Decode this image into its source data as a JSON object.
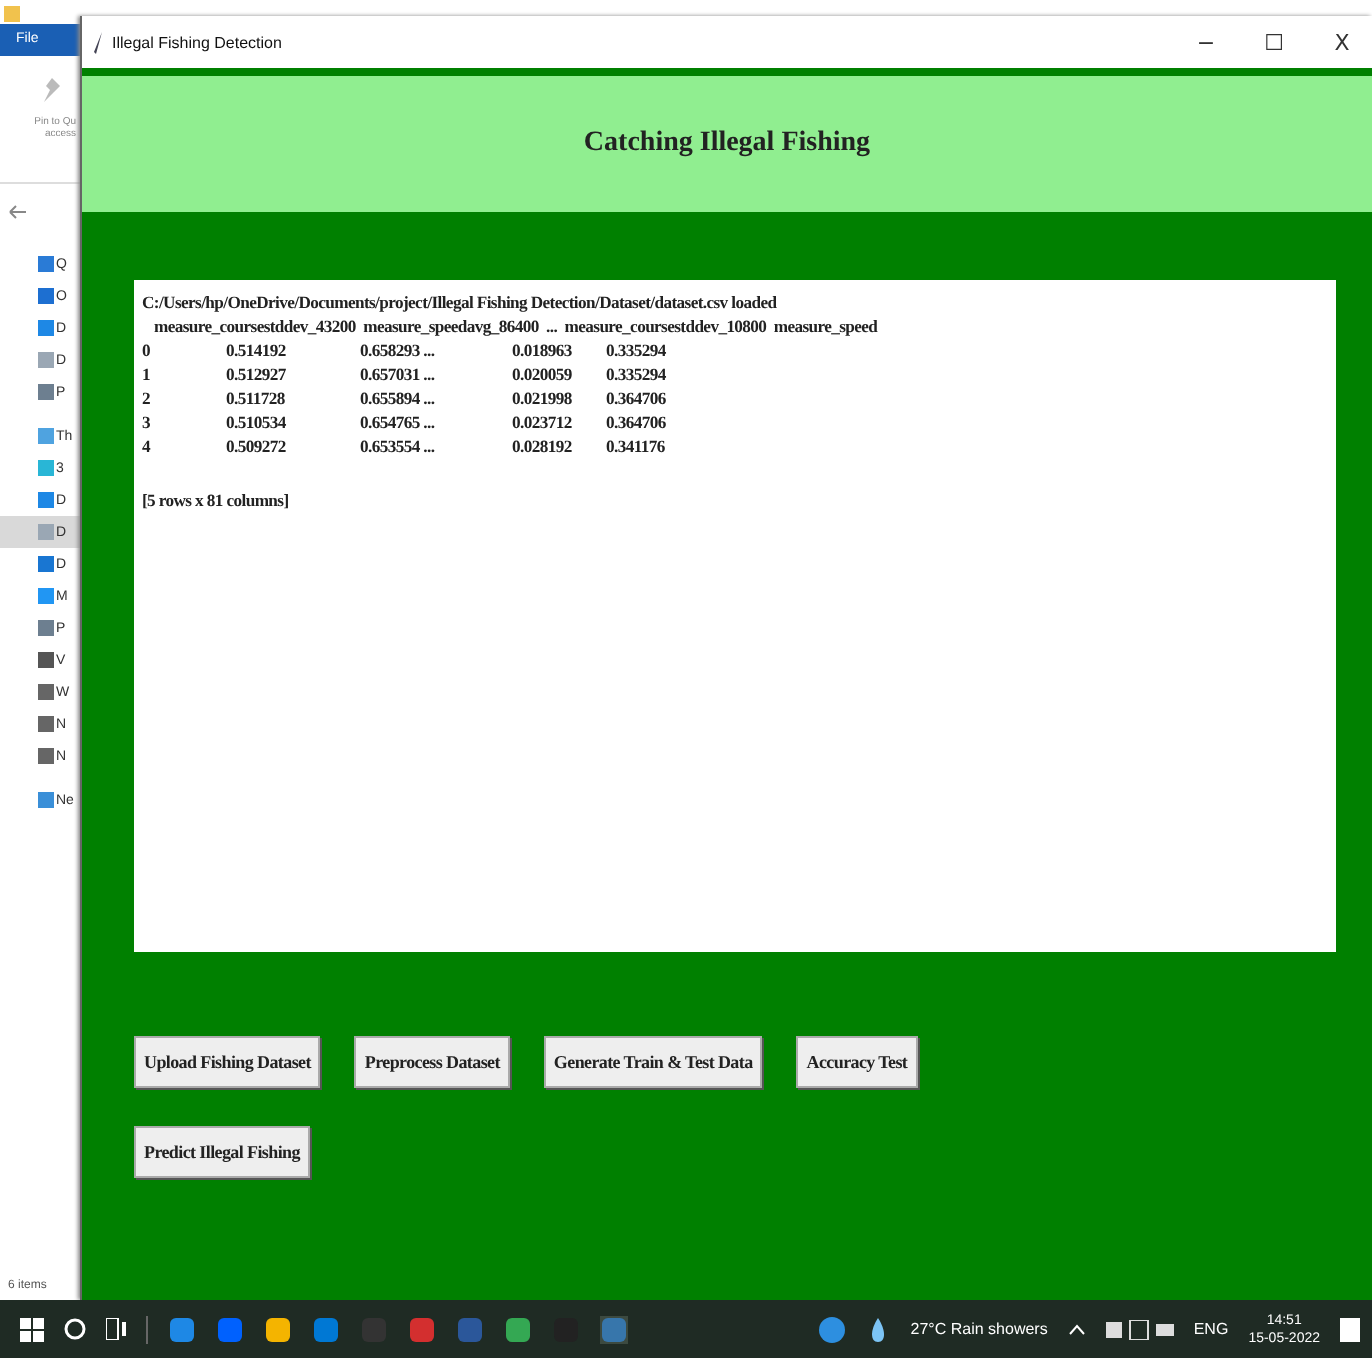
{
  "explorer": {
    "menu": "File",
    "pin_label": [
      "Pin to Qu",
      "access"
    ],
    "nav": [
      {
        "label": "Q",
        "kind": "star",
        "selected": false
      },
      {
        "label": "O",
        "kind": "cloud",
        "selected": false
      },
      {
        "label": "D",
        "kind": "desk",
        "selected": false
      },
      {
        "label": "D",
        "kind": "doc",
        "selected": false
      },
      {
        "label": "P",
        "kind": "pic",
        "selected": false
      },
      {
        "label": "Th",
        "kind": "pc",
        "selected": false
      },
      {
        "label": "3",
        "kind": "cube",
        "selected": false
      },
      {
        "label": "D",
        "kind": "desk",
        "selected": false
      },
      {
        "label": "D",
        "kind": "doc",
        "selected": true
      },
      {
        "label": "D",
        "kind": "down",
        "selected": false
      },
      {
        "label": "M",
        "kind": "music",
        "selected": false
      },
      {
        "label": "P",
        "kind": "pic",
        "selected": false
      },
      {
        "label": "V",
        "kind": "video",
        "selected": false
      },
      {
        "label": "W",
        "kind": "drive",
        "selected": false
      },
      {
        "label": "N",
        "kind": "drive",
        "selected": false
      },
      {
        "label": "N",
        "kind": "drive",
        "selected": false
      },
      {
        "label": "Ne",
        "kind": "net",
        "selected": false
      }
    ],
    "status": "6 items"
  },
  "window": {
    "title": "Illegal Fishing Detection",
    "controls": [
      "−",
      "☐",
      "X"
    ]
  },
  "header": {
    "title": "Catching Illegal Fishing"
  },
  "output": {
    "path_line": "C:/Users/hp/OneDrive/Documents/project/Illegal Fishing Detection/Dataset/dataset.csv loaded",
    "header_line": "measure_coursestddev_43200  measure_speedavg_86400  ...  measure_coursestddev_10800  measure_speed",
    "rows": [
      [
        "0",
        "0.514192",
        "0.658293 ...",
        "0.018963",
        "0.335294"
      ],
      [
        "1",
        "0.512927",
        "0.657031 ...",
        "0.020059",
        "0.335294"
      ],
      [
        "2",
        "0.511728",
        "0.655894 ...",
        "0.021998",
        "0.364706"
      ],
      [
        "3",
        "0.510534",
        "0.654765 ...",
        "0.023712",
        "0.364706"
      ],
      [
        "4",
        "0.509272",
        "0.653554 ...",
        "0.028192",
        "0.341176"
      ]
    ],
    "footer_line": "[5 rows x 81 columns]"
  },
  "buttons": [
    [
      "Upload Fishing Dataset",
      "Preprocess Dataset",
      "Generate Train & Test Data",
      "Accuracy Test"
    ],
    [
      "Predict Illegal Fishing"
    ]
  ],
  "taskbar": {
    "weather": "27°C  Rain showers",
    "language": "ENG",
    "time": "14:51",
    "date": "15-05-2022"
  }
}
